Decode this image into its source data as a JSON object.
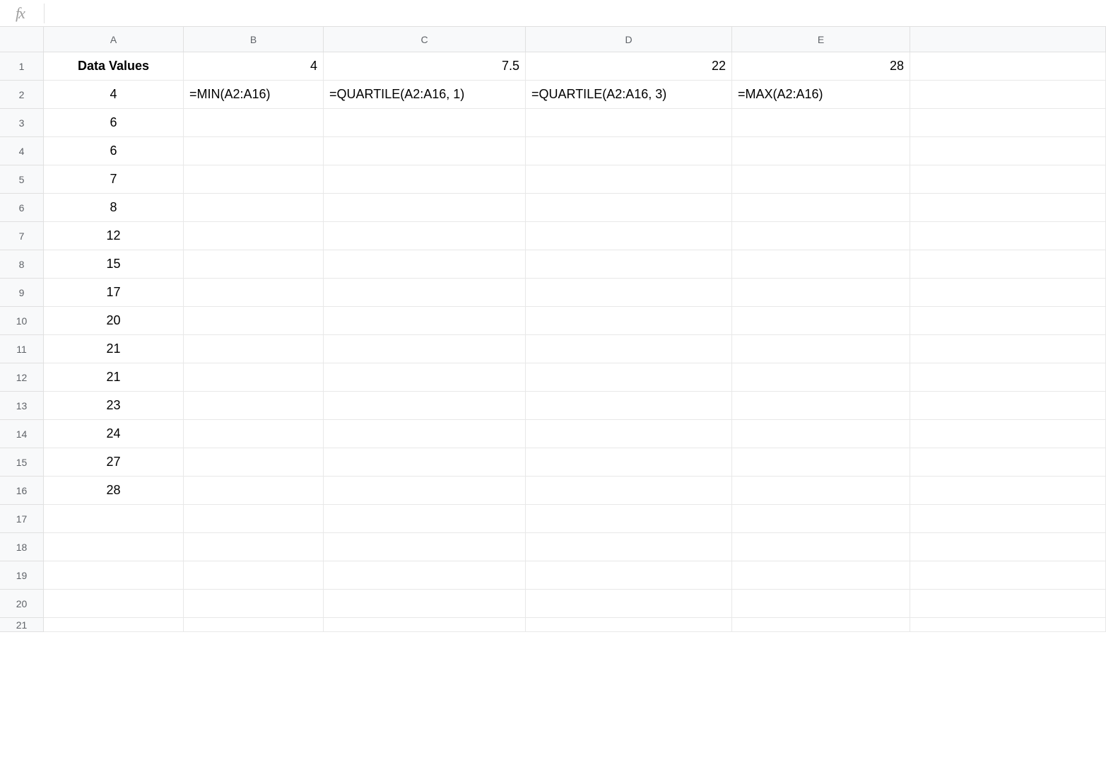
{
  "formula_bar": {
    "fx_label": "fx",
    "value": ""
  },
  "columns": [
    "A",
    "B",
    "C",
    "D",
    "E"
  ],
  "rows": [
    {
      "num": "1",
      "cells": {
        "A": {
          "v": "Data Values",
          "align": "center",
          "bold": true
        },
        "B": {
          "v": "4",
          "align": "right"
        },
        "C": {
          "v": "7.5",
          "align": "right"
        },
        "D": {
          "v": "22",
          "align": "right"
        },
        "E": {
          "v": "28",
          "align": "right"
        }
      }
    },
    {
      "num": "2",
      "cells": {
        "A": {
          "v": "4",
          "align": "center"
        },
        "B": {
          "v": "=MIN(A2:A16)",
          "align": "left"
        },
        "C": {
          "v": "=QUARTILE(A2:A16, 1)",
          "align": "left"
        },
        "D": {
          "v": "=QUARTILE(A2:A16, 3)",
          "align": "left"
        },
        "E": {
          "v": "=MAX(A2:A16)",
          "align": "left"
        }
      }
    },
    {
      "num": "3",
      "cells": {
        "A": {
          "v": "6",
          "align": "center"
        }
      }
    },
    {
      "num": "4",
      "cells": {
        "A": {
          "v": "6",
          "align": "center"
        }
      }
    },
    {
      "num": "5",
      "cells": {
        "A": {
          "v": "7",
          "align": "center"
        }
      }
    },
    {
      "num": "6",
      "cells": {
        "A": {
          "v": "8",
          "align": "center"
        }
      }
    },
    {
      "num": "7",
      "cells": {
        "A": {
          "v": "12",
          "align": "center"
        }
      }
    },
    {
      "num": "8",
      "cells": {
        "A": {
          "v": "15",
          "align": "center"
        }
      }
    },
    {
      "num": "9",
      "cells": {
        "A": {
          "v": "17",
          "align": "center"
        }
      }
    },
    {
      "num": "10",
      "cells": {
        "A": {
          "v": "20",
          "align": "center"
        }
      }
    },
    {
      "num": "11",
      "cells": {
        "A": {
          "v": "21",
          "align": "center"
        }
      }
    },
    {
      "num": "12",
      "cells": {
        "A": {
          "v": "21",
          "align": "center"
        }
      }
    },
    {
      "num": "13",
      "cells": {
        "A": {
          "v": "23",
          "align": "center"
        }
      }
    },
    {
      "num": "14",
      "cells": {
        "A": {
          "v": "24",
          "align": "center"
        }
      }
    },
    {
      "num": "15",
      "cells": {
        "A": {
          "v": "27",
          "align": "center"
        }
      }
    },
    {
      "num": "16",
      "cells": {
        "A": {
          "v": "28",
          "align": "center"
        }
      }
    },
    {
      "num": "17",
      "cells": {}
    },
    {
      "num": "18",
      "cells": {}
    },
    {
      "num": "19",
      "cells": {}
    },
    {
      "num": "20",
      "cells": {}
    },
    {
      "num": "21",
      "cells": {}
    }
  ]
}
